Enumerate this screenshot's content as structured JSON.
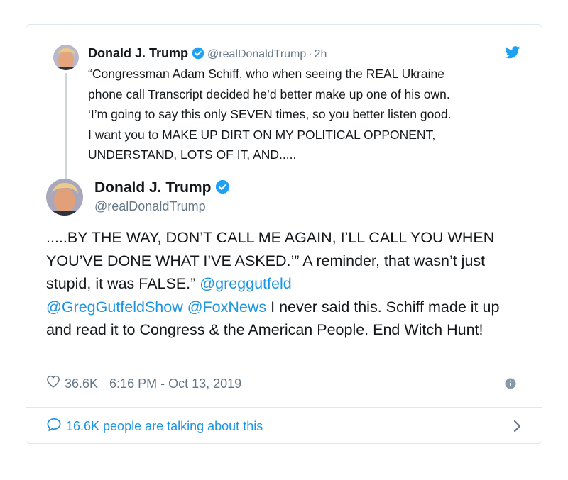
{
  "parent_tweet": {
    "name": "Donald J. Trump",
    "handle": "@realDonaldTrump",
    "separator": "·",
    "time": "2h",
    "text": "“Congressman Adam Schiff, who when seeing the REAL Ukraine\nphone call Transcript decided he’d better make up one of his own.\n‘I’m going to say this only SEVEN times, so you better listen good.\nI want you to MAKE UP DIRT ON MY POLITICAL OPPONENT,\nUNDERSTAND, LOTS OF IT, AND....."
  },
  "main_tweet": {
    "name": "Donald J. Trump",
    "handle": "@realDonaldTrump",
    "text_part1": ".....BY THE WAY, DON’T CALL ME AGAIN, I’LL CALL YOU WHEN YOU’VE DONE WHAT I’VE ASKED.’” A reminder, that wasn’t just stupid, it was FALSE.” ",
    "mention1": "@greggutfeld",
    "mention2": "@GregGutfeldShow",
    "mention3": "@FoxNews",
    "text_part2": " I never said this. Schiff made it up and read it to Congress & the American People. End Witch Hunt!",
    "likes": "36.6K",
    "timestamp": "6:16 PM - Oct 13, 2019"
  },
  "footer": {
    "talking_label": "16.6K people are talking about this"
  },
  "colors": {
    "accent": "#1b95e0",
    "secondary_text": "#657786",
    "border": "#e1e8ed"
  }
}
